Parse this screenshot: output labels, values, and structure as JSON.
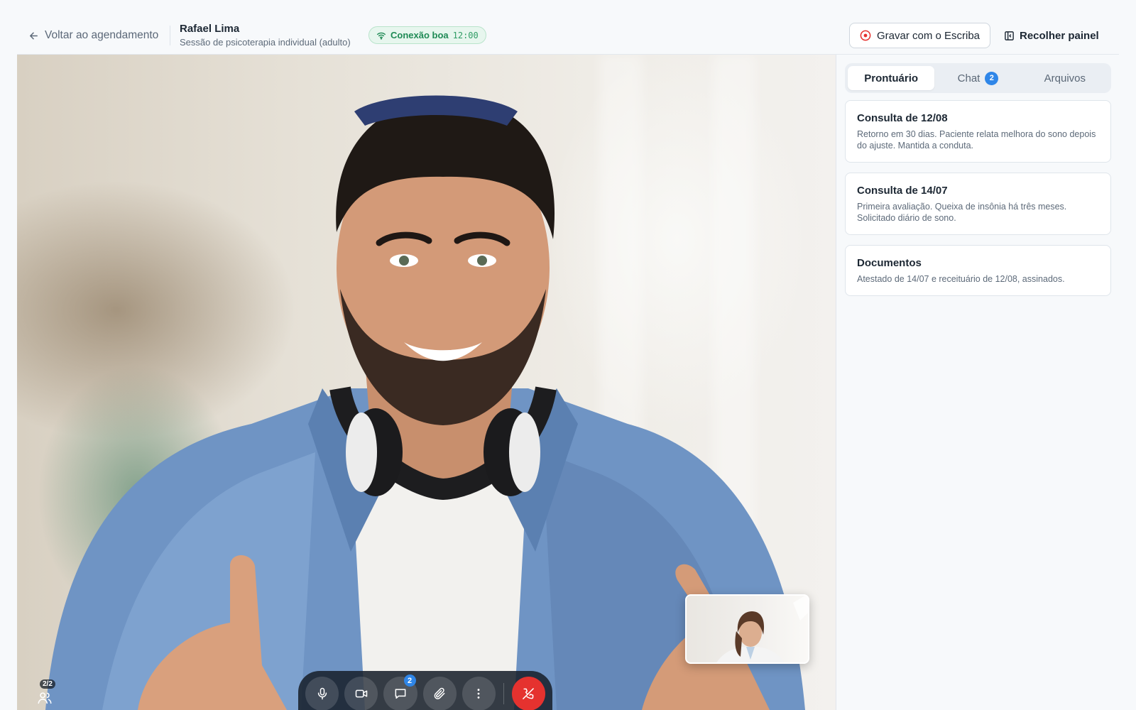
{
  "header": {
    "back_label": "Voltar ao agendamento",
    "patient_name": "Rafael Lima",
    "session_type": "Sessão de psicoterapia individual (adulto)",
    "connection_label": "Conexão boa",
    "connection_time": "12:00",
    "record_label": "Gravar com o Escriba",
    "collapse_label": "Recolher painel"
  },
  "colors": {
    "accent": "#2f86e8",
    "good_connection": "#1f8a55",
    "record_icon": "#e5322f",
    "end_call": "#e5322f"
  },
  "video": {
    "participants_count": "2/2",
    "toolbar": {
      "buttons": [
        "microphone-icon",
        "camera-icon",
        "chat-icon",
        "attach-icon",
        "more-icon",
        "end-call-icon"
      ],
      "chat_badge": "2"
    }
  },
  "panel": {
    "tabs": [
      {
        "label": "Prontuário",
        "active": true
      },
      {
        "label": "Chat",
        "badge": "2"
      },
      {
        "label": "Arquivos"
      }
    ],
    "cards": [
      {
        "title": "Consulta de 12/08",
        "text": "Retorno em 30 dias. Paciente relata melhora do sono depois do ajuste. Mantida a conduta."
      },
      {
        "title": "Consulta de 14/07",
        "text": "Primeira avaliação. Queixa de insônia há três meses. Solicitado diário de sono."
      },
      {
        "title": "Documentos",
        "text": "Atestado de 14/07 e receituário de 12/08, assinados."
      }
    ]
  }
}
